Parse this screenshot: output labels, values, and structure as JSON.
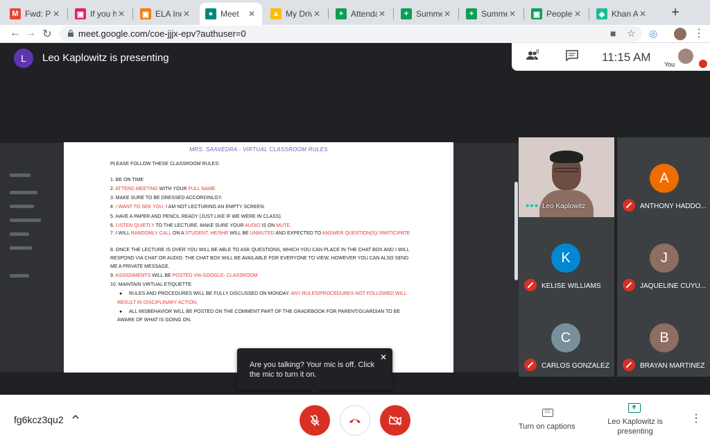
{
  "browser": {
    "tabs": [
      {
        "label": "Fwd: Pers",
        "icon": "gmail-icon",
        "color": "#ea4335",
        "glyph": "M"
      },
      {
        "label": "If you hav",
        "icon": "classroom-icon",
        "color": "#e91e63",
        "glyph": "▣"
      },
      {
        "label": "ELA Incor",
        "icon": "classroom-icon",
        "color": "#f57c00",
        "glyph": "▣"
      },
      {
        "label": "Meet",
        "icon": "meet-icon",
        "color": "#00897b",
        "glyph": "●",
        "active": true
      },
      {
        "label": "My Drive",
        "icon": "drive-icon",
        "color": "#fbbc04",
        "glyph": "▲"
      },
      {
        "label": "Attendanc",
        "icon": "sheets-icon",
        "color": "#0f9d58",
        "glyph": "+"
      },
      {
        "label": "Summer F",
        "icon": "sheets-icon",
        "color": "#0f9d58",
        "glyph": "+"
      },
      {
        "label": "Summer F",
        "icon": "sheets-icon",
        "color": "#0f9d58",
        "glyph": "+"
      },
      {
        "label": "People in",
        "icon": "classroom-icon",
        "color": "#0f9d58",
        "glyph": "▣"
      },
      {
        "label": "Khan Aca",
        "icon": "khan-icon",
        "color": "#14bf96",
        "glyph": "◆"
      }
    ],
    "url": "meet.google.com/coe-jjjx-epv?authuser=0"
  },
  "meet": {
    "presenter_initial": "L",
    "presenting_text": "Leo Kaplowitz is presenting",
    "people_count": "8",
    "time": "11:15 AM",
    "you_label": "You",
    "meeting_code": "fg6kcz3qu2",
    "captions_label": "Turn on captions",
    "present_label": "Leo Kaplowitz is presenting",
    "toast": "Are you talking? Your mic is off. Click the mic to turn it on.",
    "participants": [
      {
        "name": "Leo Kaplowitz",
        "video": true
      },
      {
        "name": "ANTHONY HADDO...",
        "initial": "A",
        "color": "#ef6c00"
      },
      {
        "name": "KELISE WILLIAMS",
        "initial": "K",
        "color": "#0288d1"
      },
      {
        "name": "JAQUELINE CUYU...",
        "initial": "J",
        "color": "#8d6e63"
      },
      {
        "name": "CARLOS GONZALEZ",
        "initial": "C",
        "color": "#78909c"
      },
      {
        "name": "BRAYAN MARTINEZ",
        "initial": "B",
        "color": "#8d6e63"
      }
    ]
  },
  "doc": {
    "title": "MRS. SAAVEDRA - VIRTUAL CLASSROOM RULES",
    "intro": "PLEASE FOLLOW THESE CLASSROOM RULES:",
    "r1": "1. BE ON TIME",
    "r2a": "2. ",
    "r2b": "ATTEND MEETING",
    "r2c": " WITH YOUR ",
    "r2d": "FULL NAME",
    "r3": "3. MAKE SURE TO BE DRESSED ACCORDINLGY.",
    "r4a": "4. ",
    "r4b": "I WANT TO SEE YOU,",
    "r4c": " I AM NOT LECTURING AN EMPTY SCREEN.",
    "r5": "5. HAVE A PAPER AND PENCIL READY (JUST LIKE IF WE WERE IN CLASS)",
    "r6a": "6. ",
    "r6b": "LISTEN QUIETLY",
    "r6c": " TO THE LECTURE. MAKE SURE YOUR ",
    "r6d": "AUDIO",
    "r6e": " IS ON ",
    "r6f": "MUTE.",
    "r7a": "7. I WILL ",
    "r7b": "RANDOMLY CALL",
    "r7c": " ON A ",
    "r7d": "STUDENT. HE/SHE",
    "r7e": " WILL BE ",
    "r7f": "UNMUTED",
    "r7g": " AND EXPECTED TO ",
    "r7h": "ANSWER QUESTION(S)/ PARTICIPATE",
    "r8a": "8. ONCE THE LECTURE IS OVER YOU WILL BE ABLE TO ASK QUESTIONS, WHICH YOU CAN PLACE IN THE CHAT BOX AND I WILL",
    "r8b": "RESPOND VIA CHAT OR AUDIO. THE CHAT BOX WILL BE AVAILABLE FOR EVERYONE TO VIEW, HOWEVER YOU CAN ALSO SEND",
    "r8c": "ME A PRIVATE MESSAGE.",
    "r9a": "9. ",
    "r9b": "ASSIGNMENTS",
    "r9c": " WILL BE ",
    "r9d": "POSTED VIA GOOGLE- CLASSROOM.",
    "r10": "10. MAINTAIN VIRTUAL ETIQUETTE.",
    "b1a": "RULES AND PROCEDURES WILL BE FULLY DISCUSSED ON MONDAY. ",
    "b1b": "ANY RULES/PROCEDURES NOT FOLLOWED WILL",
    "b1c": "RESULT IN DISCIPLINARY ACTION.",
    "b2a": "ALL MISBEHAVIOR WILL BE POSTED ON THE COMMENT PART OF THE GRADEBOOK FOR PARENT/GUARDIAN TO BE",
    "b2b": "AWARE OF WHAT IS GOING ON."
  }
}
